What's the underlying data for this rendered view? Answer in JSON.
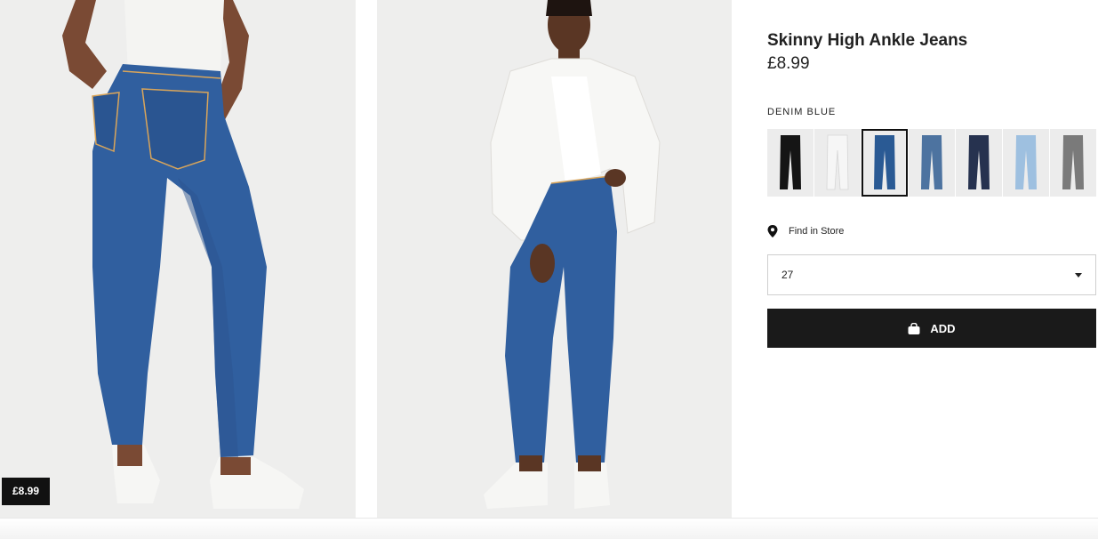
{
  "product": {
    "name": "Skinny High Ankle Jeans",
    "price": "£8.99",
    "image_price_tag": "£8.99",
    "selected_color": "DENIM BLUE"
  },
  "swatches": [
    {
      "color": "#151515",
      "name": "black"
    },
    {
      "color": "#f6f6f6",
      "name": "white"
    },
    {
      "color": "#2a5a94",
      "name": "denim-blue",
      "selected": true
    },
    {
      "color": "#4d73a0",
      "name": "denim-mid-blue"
    },
    {
      "color": "#26324f",
      "name": "dark-blue"
    },
    {
      "color": "#9ec0e0",
      "name": "light-blue"
    },
    {
      "color": "#7a7a7a",
      "name": "patterned"
    }
  ],
  "store": {
    "label": "Find in Store",
    "icon": "location-pin-icon"
  },
  "size_select": {
    "value": "27"
  },
  "add_button": {
    "label": "ADD",
    "icon": "shopping-bag-icon"
  }
}
